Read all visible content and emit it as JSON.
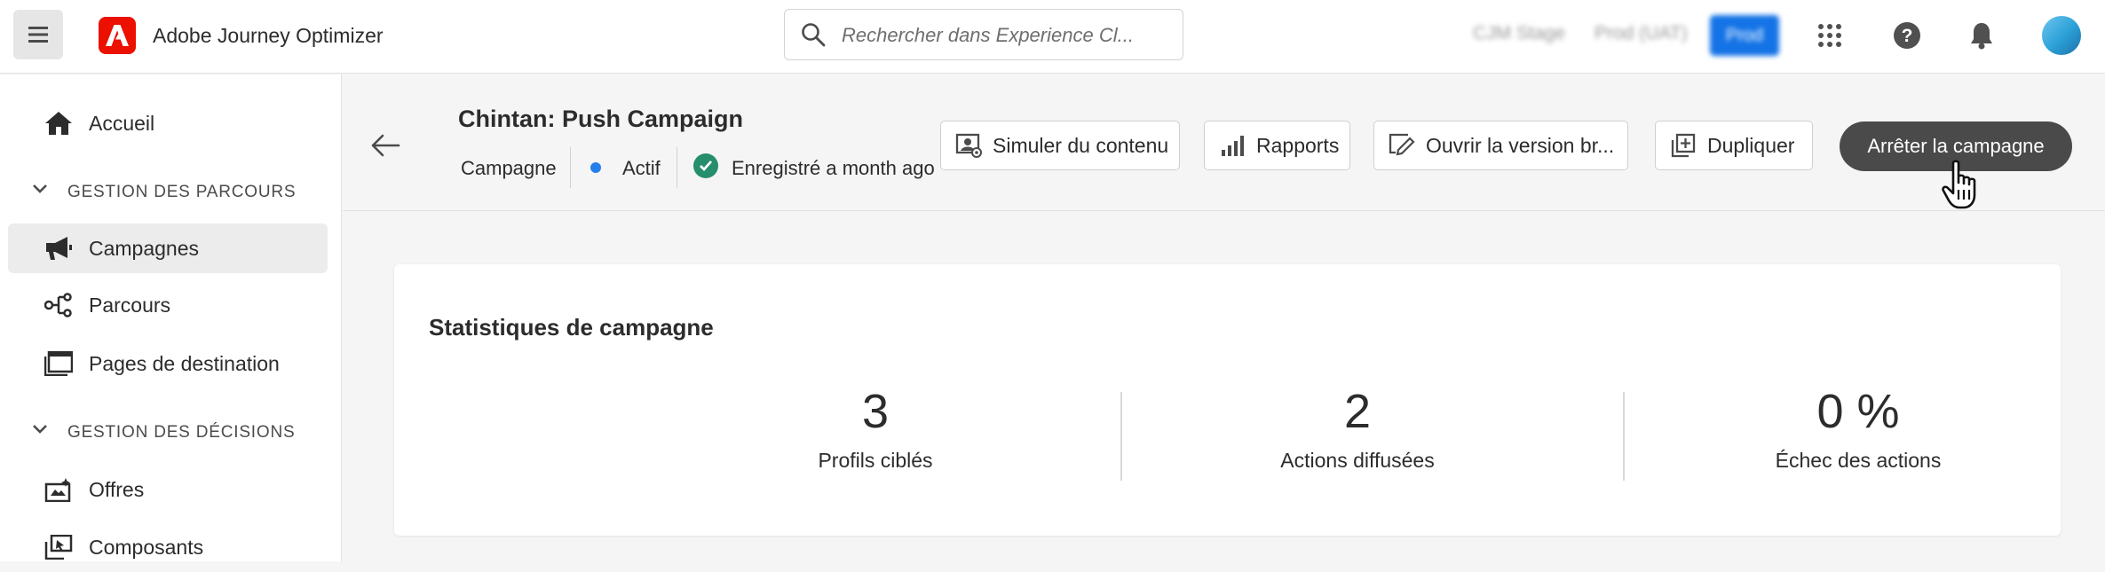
{
  "header": {
    "app_title": "Adobe Journey Optimizer",
    "search_placeholder": "Rechercher dans Experience Cl...",
    "org_items": [
      "CJM Stage",
      "Prod (UAT)"
    ],
    "org_active": "Prod",
    "icons": [
      "menu-icon",
      "adobe-logo",
      "search-icon",
      "apps-grid-icon",
      "help-icon",
      "bell-icon",
      "avatar"
    ]
  },
  "sidebar": {
    "items": [
      {
        "label": "Accueil",
        "icon": "home-icon"
      },
      {
        "label": "Campagnes",
        "icon": "megaphone-icon",
        "selected": true
      },
      {
        "label": "Parcours",
        "icon": "journey-icon"
      },
      {
        "label": "Pages de destination",
        "icon": "landing-page-icon"
      },
      {
        "label": "Offres",
        "icon": "offers-icon"
      },
      {
        "label": "Composants",
        "icon": "components-icon"
      }
    ],
    "sections": [
      "GESTION DES PARCOURS",
      "GESTION DES DÉCISIONS"
    ]
  },
  "campaign": {
    "title": "Chintan: Push Campaign",
    "type": "Campagne",
    "status": "Actif",
    "saved": "Enregistré a month ago",
    "status_color": "#2680eb"
  },
  "actions": {
    "simulate": "Simuler du contenu",
    "reports": "Rapports",
    "open_draft": "Ouvrir la version br...",
    "duplicate": "Dupliquer",
    "stop": "Arrêter la campagne"
  },
  "stats": {
    "title": "Statistiques de campagne",
    "items": [
      {
        "value": "3",
        "label": "Profils ciblés"
      },
      {
        "value": "2",
        "label": "Actions diffusées"
      },
      {
        "value": "0 %",
        "label": "Échec des actions"
      }
    ]
  },
  "colors": {
    "brand": "#eb1000",
    "accent": "#1473e6",
    "success": "#268e6c",
    "dark_button": "#4a4a4a"
  }
}
